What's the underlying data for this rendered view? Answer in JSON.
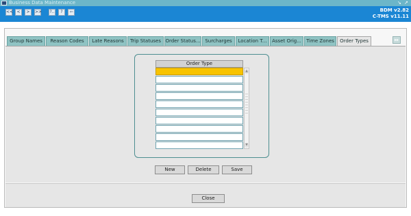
{
  "window": {
    "title": "Business Data Maintenance",
    "controls": [
      "↘",
      "↗"
    ]
  },
  "toolbar": {
    "buttons": [
      "<<",
      "<",
      ">",
      ">>",
      "?..",
      "?",
      "⇦"
    ],
    "version_line1": "BDM v2.82",
    "version_line2": "C-TMS v11.11"
  },
  "tabs": [
    {
      "label": "Group Names",
      "active": false
    },
    {
      "label": "Reason Codes",
      "active": false
    },
    {
      "label": "Late Reasons",
      "active": false
    },
    {
      "label": "Trip Statuses",
      "active": false
    },
    {
      "label": "Order Status...",
      "active": false
    },
    {
      "label": "Surcharges",
      "active": false
    },
    {
      "label": "Location T...",
      "active": false
    },
    {
      "label": "Asset Orig...",
      "active": false
    },
    {
      "label": "Time Zones",
      "active": false
    },
    {
      "label": "Order Types",
      "active": true
    }
  ],
  "tab_scroll_label": "▸▸",
  "grid": {
    "column_header": "Order Type",
    "rows": [
      "",
      "",
      "",
      "",
      "",
      "",
      "",
      "",
      "",
      ""
    ],
    "selected_row": 0
  },
  "actions": {
    "new_label": "New",
    "delete_label": "Delete",
    "save_label": "Save"
  },
  "footer": {
    "close_label": "Close"
  },
  "colors": {
    "titlebar": "#6cb6c9",
    "toolbar": "#1b86d4",
    "tab": "#8fc3c3",
    "selected_row": "#f8c300",
    "panel_border": "#4d8e90"
  }
}
